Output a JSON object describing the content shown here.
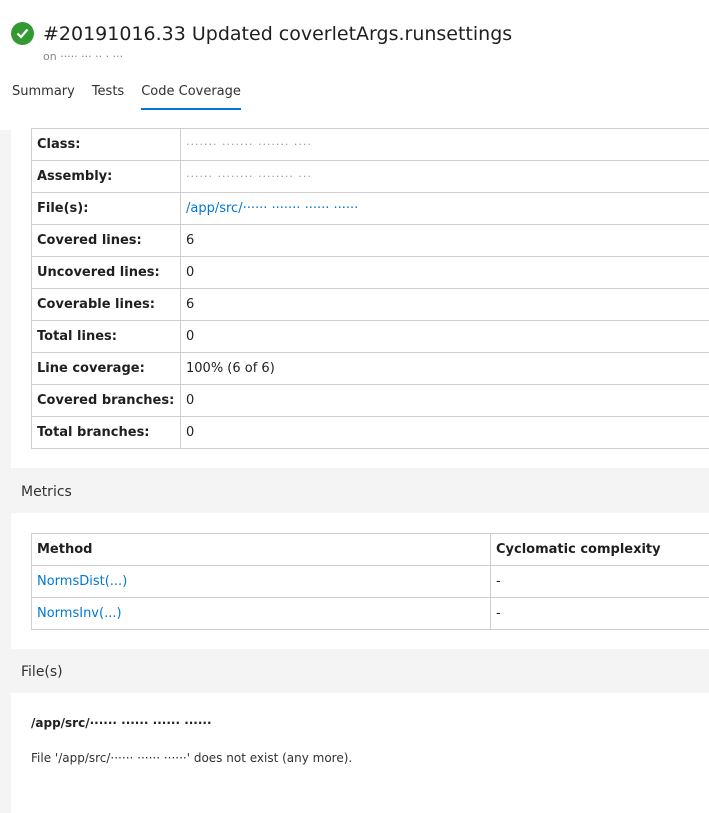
{
  "header": {
    "title": "#20191016.33 Updated coverletArgs.runsettings",
    "subtitle": "on ·····  ··· ·· · ···",
    "status_color": "#339933",
    "status_icon": "check-icon"
  },
  "tabs": [
    {
      "label": "Summary"
    },
    {
      "label": "Tests"
    },
    {
      "label": "Code Coverage"
    }
  ],
  "properties": [
    {
      "label": "Class:",
      "value": "·······  ······· ·······  ····"
    },
    {
      "label": "Assembly:",
      "value": "······ ········ ········  ···"
    },
    {
      "label": "File(s):",
      "value": "/app/src/······ ······· ······ ······"
    },
    {
      "label": "Covered lines:",
      "value": "6"
    },
    {
      "label": "Uncovered lines:",
      "value": "0"
    },
    {
      "label": "Coverable lines:",
      "value": "6"
    },
    {
      "label": "Total lines:",
      "value": "0"
    },
    {
      "label": "Line coverage:",
      "value": "100% (6 of 6)"
    },
    {
      "label": "Covered branches:",
      "value": "0"
    },
    {
      "label": "Total branches:",
      "value": "0"
    }
  ],
  "metrics": {
    "section_title": "Metrics",
    "columns": [
      "Method",
      "Cyclomatic complexity"
    ],
    "rows": [
      {
        "method": "NormsDist(...)",
        "complexity": "-"
      },
      {
        "method": "NormsInv(...)",
        "complexity": "-"
      }
    ]
  },
  "files": {
    "section_title": "File(s)",
    "path": "/app/src/······ ······ ······ ······",
    "message": "File '/app/src/······ ······ ······' does not exist (any more)."
  }
}
